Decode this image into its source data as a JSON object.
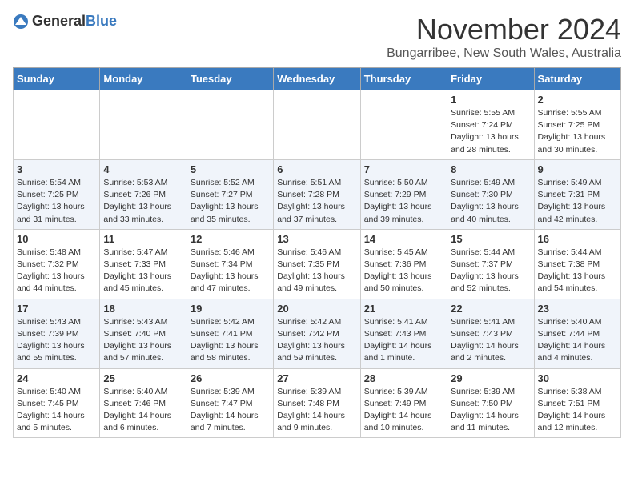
{
  "header": {
    "logo_general": "General",
    "logo_blue": "Blue",
    "month_title": "November 2024",
    "location": "Bungarribee, New South Wales, Australia"
  },
  "weekdays": [
    "Sunday",
    "Monday",
    "Tuesday",
    "Wednesday",
    "Thursday",
    "Friday",
    "Saturday"
  ],
  "weeks": [
    [
      {
        "day": "",
        "info": ""
      },
      {
        "day": "",
        "info": ""
      },
      {
        "day": "",
        "info": ""
      },
      {
        "day": "",
        "info": ""
      },
      {
        "day": "",
        "info": ""
      },
      {
        "day": "1",
        "info": "Sunrise: 5:55 AM\nSunset: 7:24 PM\nDaylight: 13 hours\nand 28 minutes."
      },
      {
        "day": "2",
        "info": "Sunrise: 5:55 AM\nSunset: 7:25 PM\nDaylight: 13 hours\nand 30 minutes."
      }
    ],
    [
      {
        "day": "3",
        "info": "Sunrise: 5:54 AM\nSunset: 7:25 PM\nDaylight: 13 hours\nand 31 minutes."
      },
      {
        "day": "4",
        "info": "Sunrise: 5:53 AM\nSunset: 7:26 PM\nDaylight: 13 hours\nand 33 minutes."
      },
      {
        "day": "5",
        "info": "Sunrise: 5:52 AM\nSunset: 7:27 PM\nDaylight: 13 hours\nand 35 minutes."
      },
      {
        "day": "6",
        "info": "Sunrise: 5:51 AM\nSunset: 7:28 PM\nDaylight: 13 hours\nand 37 minutes."
      },
      {
        "day": "7",
        "info": "Sunrise: 5:50 AM\nSunset: 7:29 PM\nDaylight: 13 hours\nand 39 minutes."
      },
      {
        "day": "8",
        "info": "Sunrise: 5:49 AM\nSunset: 7:30 PM\nDaylight: 13 hours\nand 40 minutes."
      },
      {
        "day": "9",
        "info": "Sunrise: 5:49 AM\nSunset: 7:31 PM\nDaylight: 13 hours\nand 42 minutes."
      }
    ],
    [
      {
        "day": "10",
        "info": "Sunrise: 5:48 AM\nSunset: 7:32 PM\nDaylight: 13 hours\nand 44 minutes."
      },
      {
        "day": "11",
        "info": "Sunrise: 5:47 AM\nSunset: 7:33 PM\nDaylight: 13 hours\nand 45 minutes."
      },
      {
        "day": "12",
        "info": "Sunrise: 5:46 AM\nSunset: 7:34 PM\nDaylight: 13 hours\nand 47 minutes."
      },
      {
        "day": "13",
        "info": "Sunrise: 5:46 AM\nSunset: 7:35 PM\nDaylight: 13 hours\nand 49 minutes."
      },
      {
        "day": "14",
        "info": "Sunrise: 5:45 AM\nSunset: 7:36 PM\nDaylight: 13 hours\nand 50 minutes."
      },
      {
        "day": "15",
        "info": "Sunrise: 5:44 AM\nSunset: 7:37 PM\nDaylight: 13 hours\nand 52 minutes."
      },
      {
        "day": "16",
        "info": "Sunrise: 5:44 AM\nSunset: 7:38 PM\nDaylight: 13 hours\nand 54 minutes."
      }
    ],
    [
      {
        "day": "17",
        "info": "Sunrise: 5:43 AM\nSunset: 7:39 PM\nDaylight: 13 hours\nand 55 minutes."
      },
      {
        "day": "18",
        "info": "Sunrise: 5:43 AM\nSunset: 7:40 PM\nDaylight: 13 hours\nand 57 minutes."
      },
      {
        "day": "19",
        "info": "Sunrise: 5:42 AM\nSunset: 7:41 PM\nDaylight: 13 hours\nand 58 minutes."
      },
      {
        "day": "20",
        "info": "Sunrise: 5:42 AM\nSunset: 7:42 PM\nDaylight: 13 hours\nand 59 minutes."
      },
      {
        "day": "21",
        "info": "Sunrise: 5:41 AM\nSunset: 7:43 PM\nDaylight: 14 hours\nand 1 minute."
      },
      {
        "day": "22",
        "info": "Sunrise: 5:41 AM\nSunset: 7:43 PM\nDaylight: 14 hours\nand 2 minutes."
      },
      {
        "day": "23",
        "info": "Sunrise: 5:40 AM\nSunset: 7:44 PM\nDaylight: 14 hours\nand 4 minutes."
      }
    ],
    [
      {
        "day": "24",
        "info": "Sunrise: 5:40 AM\nSunset: 7:45 PM\nDaylight: 14 hours\nand 5 minutes."
      },
      {
        "day": "25",
        "info": "Sunrise: 5:40 AM\nSunset: 7:46 PM\nDaylight: 14 hours\nand 6 minutes."
      },
      {
        "day": "26",
        "info": "Sunrise: 5:39 AM\nSunset: 7:47 PM\nDaylight: 14 hours\nand 7 minutes."
      },
      {
        "day": "27",
        "info": "Sunrise: 5:39 AM\nSunset: 7:48 PM\nDaylight: 14 hours\nand 9 minutes."
      },
      {
        "day": "28",
        "info": "Sunrise: 5:39 AM\nSunset: 7:49 PM\nDaylight: 14 hours\nand 10 minutes."
      },
      {
        "day": "29",
        "info": "Sunrise: 5:39 AM\nSunset: 7:50 PM\nDaylight: 14 hours\nand 11 minutes."
      },
      {
        "day": "30",
        "info": "Sunrise: 5:38 AM\nSunset: 7:51 PM\nDaylight: 14 hours\nand 12 minutes."
      }
    ]
  ]
}
